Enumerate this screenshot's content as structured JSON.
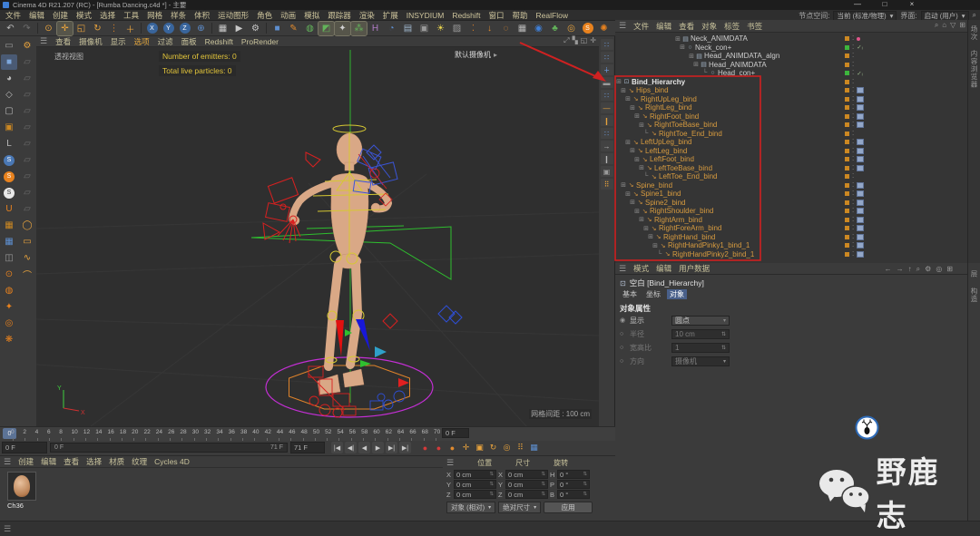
{
  "window": {
    "title": "Cinema 4D R21.207 (RC) - [Rumba Dancing.c4d *] - 主要",
    "controls": [
      "—",
      "□",
      "×"
    ]
  },
  "menubar": {
    "items": [
      "文件",
      "编辑",
      "创建",
      "模式",
      "选择",
      "工具",
      "网格",
      "样条",
      "体积",
      "运动图形",
      "角色",
      "动画",
      "模拟",
      "跟踪器",
      "渲染",
      "扩展",
      "INSYDIUM",
      "Redshift",
      "窗口",
      "帮助",
      "RealFlow"
    ],
    "node_space_label": "节点空间:",
    "node_space_value": "当前 (标准/物理)",
    "interface_label": "界面:",
    "interface_value": "启动 (用户)"
  },
  "toolbar": {
    "icons": [
      {
        "name": "undo",
        "glyph": "↶",
        "color": "#b8b8b8"
      },
      {
        "name": "redo",
        "glyph": "↷",
        "color": "#6e6e6e"
      },
      {
        "name": "sep"
      },
      {
        "name": "live-selection",
        "glyph": "⊙",
        "color": "#e8a33d"
      },
      {
        "name": "move-tool",
        "glyph": "✛",
        "color": "#e8a33d",
        "active": true
      },
      {
        "name": "scale-tool",
        "glyph": "◱",
        "color": "#e8a33d"
      },
      {
        "name": "rotate-tool",
        "glyph": "↻",
        "color": "#e8a33d"
      },
      {
        "name": "recent-tools",
        "glyph": "⋮",
        "color": "#cc7a29"
      },
      {
        "name": "add-tool",
        "glyph": "＋",
        "color": "#e8a33d"
      },
      {
        "name": "sep"
      },
      {
        "name": "lock-x",
        "glyph": "X",
        "color": "#fff",
        "bg": "#39659c",
        "round": true
      },
      {
        "name": "lock-y",
        "glyph": "Y",
        "color": "#fff",
        "bg": "#39659c",
        "round": true
      },
      {
        "name": "lock-z",
        "glyph": "Z",
        "color": "#fff",
        "bg": "#39659c",
        "round": true
      },
      {
        "name": "coordinate-system",
        "glyph": "⊕",
        "color": "#5e8fd0"
      },
      {
        "name": "sep"
      },
      {
        "name": "render-view",
        "glyph": "▦",
        "color": "#c8c8c8"
      },
      {
        "name": "render-marked",
        "glyph": "▶",
        "color": "#c8c8c8"
      },
      {
        "name": "render-settings",
        "glyph": "⚙",
        "color": "#c8c8c8"
      },
      {
        "name": "sep"
      },
      {
        "name": "primitive-cube",
        "glyph": "■",
        "color": "#5e8fd0"
      },
      {
        "name": "pen-spline",
        "glyph": "✎",
        "color": "#e08a2e"
      },
      {
        "name": "subdivision-surface",
        "glyph": "◍",
        "color": "#63b35a"
      },
      {
        "name": "bend-deformer",
        "glyph": "◩",
        "color": "#63b35a",
        "active": true
      },
      {
        "name": "mograph",
        "glyph": "✦",
        "color": "#d0d0d0",
        "active": true
      },
      {
        "name": "cloner",
        "glyph": "⁂",
        "color": "#63b35a",
        "active": true
      },
      {
        "name": "field-force",
        "glyph": "H",
        "color": "#b07cc6"
      },
      {
        "name": "volume",
        "glyph": "◔",
        "color": "#5e8fd0"
      },
      {
        "name": "floor",
        "glyph": "▤",
        "color": "#9fb6cc"
      },
      {
        "name": "camera",
        "glyph": "▣",
        "color": "#9a9a9a"
      },
      {
        "name": "light",
        "glyph": "☀",
        "color": "#e8d44d"
      },
      {
        "name": "sky",
        "glyph": "▨",
        "color": "#9a9a9a"
      },
      {
        "name": "dots-menu",
        "glyph": "⁚",
        "color": "#cc7a29"
      },
      {
        "name": "solo-arrow",
        "glyph": "↓",
        "color": "#e08a2e"
      },
      {
        "name": "dotted-selection",
        "glyph": "◌",
        "color": "#e08a2e"
      },
      {
        "name": "array-grid",
        "glyph": "▦",
        "color": "#b8b8b8"
      },
      {
        "name": "xref",
        "glyph": "◉",
        "color": "#3f7fd6"
      },
      {
        "name": "jb-plugin",
        "glyph": "♣",
        "color": "#63b35a"
      },
      {
        "name": "target-gear",
        "glyph": "◎",
        "color": "#e8a33d"
      },
      {
        "name": "s-logo",
        "glyph": "S",
        "color": "#fff",
        "bg": "#e8821e",
        "round": true
      },
      {
        "name": "xparticles",
        "glyph": "✺",
        "color": "#e8821e"
      }
    ]
  },
  "left_toolbar": {
    "col_a": [
      {
        "name": "make-editable",
        "glyph": "▭",
        "color": "#9a9a9a"
      },
      {
        "name": "model-mode",
        "glyph": "■",
        "color": "#7da7dc",
        "active": true
      },
      {
        "name": "texture-mode",
        "glyph": "◕",
        "color": "#b8b8b8"
      },
      {
        "name": "workplane-mode",
        "glyph": "◇",
        "color": "#b8b8b8"
      },
      {
        "name": "object-mode",
        "glyph": "▢",
        "color": "#b8b8b8"
      },
      {
        "name": "animation-mode",
        "glyph": "▣",
        "color": "#cc8822"
      },
      {
        "name": "axis-mode",
        "glyph": "L",
        "color": "#b8b8b8"
      },
      {
        "name": "badge-blue-s",
        "glyph": "S",
        "color": "#fff",
        "bg": "#4a78b5"
      },
      {
        "name": "badge-orange-s",
        "glyph": "S",
        "color": "#fff",
        "bg": "#e8821e"
      },
      {
        "name": "badge-white-s",
        "glyph": "S",
        "color": "#333",
        "bg": "#e8e8e8"
      },
      {
        "name": "magnet-snap",
        "glyph": "U",
        "color": "#e8821e"
      },
      {
        "name": "grid-orange",
        "glyph": "▦",
        "color": "#cc8822"
      },
      {
        "name": "grid-blue",
        "glyph": "▦",
        "color": "#5e8fd0"
      },
      {
        "name": "grid-dark",
        "glyph": "◫",
        "color": "#9a9a9a"
      },
      {
        "name": "xp-circle-1",
        "glyph": "⊙",
        "color": "#e8821e"
      },
      {
        "name": "xp-circle-2",
        "glyph": "◍",
        "color": "#e8821e"
      },
      {
        "name": "xp-circle-3",
        "glyph": "✦",
        "color": "#e8821e"
      },
      {
        "name": "xp-circle-4",
        "glyph": "◎",
        "color": "#e8821e"
      },
      {
        "name": "xp-circle-5",
        "glyph": "❋",
        "color": "#e8821e"
      }
    ],
    "col_b": [
      {
        "name": "gear-cursor",
        "glyph": "⚙",
        "color": "#e8a33d"
      },
      {
        "name": "tool-dim-1",
        "glyph": "▱",
        "color": "#6a6a6a"
      },
      {
        "name": "tool-dim-2",
        "glyph": "▱",
        "color": "#6a6a6a"
      },
      {
        "name": "tool-dim-3",
        "glyph": "▱",
        "color": "#6a6a6a"
      },
      {
        "name": "tool-dim-4",
        "glyph": "▱",
        "color": "#6a6a6a"
      },
      {
        "name": "tool-dim-5",
        "glyph": "▱",
        "color": "#6a6a6a"
      },
      {
        "name": "tool-dim-6",
        "glyph": "▱",
        "color": "#6a6a6a"
      },
      {
        "name": "tool-dim-7",
        "glyph": "▱",
        "color": "#6a6a6a"
      },
      {
        "name": "tool-dim-8",
        "glyph": "▱",
        "color": "#6a6a6a"
      },
      {
        "name": "tool-dim-9",
        "glyph": "▱",
        "color": "#6a6a6a"
      },
      {
        "name": "tool-dim-10",
        "glyph": "▱",
        "color": "#6a6a6a"
      },
      {
        "name": "select-circle",
        "glyph": "◯",
        "color": "#e8a33d"
      },
      {
        "name": "select-rect",
        "glyph": "▭",
        "color": "#e8a33d"
      },
      {
        "name": "select-lasso",
        "glyph": "∿",
        "color": "#e8a33d"
      },
      {
        "name": "select-poly",
        "glyph": "⌒",
        "color": "#e8a33d"
      }
    ]
  },
  "right_strip": {
    "icons": [
      {
        "name": "char-tool-1",
        "glyph": "∷",
        "color": "#6d9ce0"
      },
      {
        "name": "char-tool-2",
        "glyph": "∷",
        "color": "#6d9ce0"
      },
      {
        "name": "char-tool-3",
        "glyph": "∔",
        "color": "#6d9ce0"
      },
      {
        "name": "char-tool-4",
        "glyph": "▬",
        "color": "#9a9a9a"
      },
      {
        "name": "char-tool-5",
        "glyph": "∷",
        "color": "#6d9ce0"
      },
      {
        "name": "char-tool-6",
        "glyph": "—",
        "color": "#e8a33d"
      },
      {
        "name": "char-tool-7",
        "glyph": "❙",
        "color": "#e8a33d"
      },
      {
        "name": "char-tool-8",
        "glyph": "∷",
        "color": "#6d9ce0"
      },
      {
        "name": "char-tool-9",
        "glyph": "→",
        "color": "#b8b8b8"
      },
      {
        "name": "char-tool-10",
        "glyph": "❙",
        "color": "#b8b8b8"
      },
      {
        "name": "char-tool-11",
        "glyph": "▣",
        "color": "#9a9a9a"
      },
      {
        "name": "char-tool-12",
        "glyph": "⠿",
        "color": "#e8a33d"
      }
    ]
  },
  "viewport": {
    "menu": [
      "查看",
      "摄像机",
      "显示",
      "选项",
      "过滤",
      "面板",
      "Redshift",
      "ProRender"
    ],
    "highlight_item": "选项",
    "corner_icons": [
      "⤢",
      "▚",
      "◱",
      "✛"
    ],
    "view_label": "透视视图",
    "overlay": [
      "Number of emitters: 0",
      "Total live particles: 0"
    ],
    "camera_label": "默认摄像机",
    "grid_label": "网格间距 : 100 cm",
    "axis_x": "X",
    "axis_y": "Y"
  },
  "object_manager": {
    "menu": [
      "文件",
      "编辑",
      "查看",
      "对象",
      "标签",
      "书签"
    ],
    "header_icons": [
      "⌕",
      "⌂",
      "▽",
      "⊞"
    ],
    "side_tabs": [
      "场次",
      "内容浏览器"
    ],
    "rows": [
      {
        "label": "Neck_ANIMDATA",
        "indent": 13,
        "color": "grey",
        "icon": "anim",
        "exp": "⊞",
        "square": "orange",
        "tag": "reddot"
      },
      {
        "label": "Neck_con+",
        "indent": 14,
        "color": "grey",
        "icon": "con",
        "exp": "⊞",
        "square": "green",
        "tag": "check"
      },
      {
        "label": "Head_ANIMDATA_algn",
        "indent": 16,
        "color": "grey",
        "icon": "anim",
        "exp": "⊞",
        "square": "orange",
        "tag": "none"
      },
      {
        "label": "Head_ANIMDATA",
        "indent": 17,
        "color": "grey",
        "icon": "anim",
        "exp": "⊞",
        "square": "orange",
        "tag": "none"
      },
      {
        "label": "Head_con+",
        "indent": 19,
        "color": "grey",
        "icon": "con",
        "exp": "└",
        "square": "green",
        "tag": "check"
      },
      {
        "label": "Bind_Hierarchy",
        "indent": 0,
        "color": "white",
        "icon": "null",
        "exp": "⊞",
        "square": "orange",
        "tag": "none"
      },
      {
        "label": "Hips_bind",
        "indent": 1,
        "color": "orange",
        "icon": "bone",
        "exp": "⊞",
        "square": "orange",
        "tag": "joint"
      },
      {
        "label": "RightUpLeg_bind",
        "indent": 2,
        "color": "orange",
        "icon": "bone",
        "exp": "⊞",
        "square": "orange",
        "tag": "joint"
      },
      {
        "label": "RightLeg_bind",
        "indent": 3,
        "color": "orange",
        "icon": "bone",
        "exp": "⊞",
        "square": "orange",
        "tag": "joint"
      },
      {
        "label": "RightFoot_bind",
        "indent": 4,
        "color": "orange",
        "icon": "bone",
        "exp": "⊞",
        "square": "orange",
        "tag": "joint"
      },
      {
        "label": "RightToeBase_bind",
        "indent": 5,
        "color": "orange",
        "icon": "bone",
        "exp": "⊞",
        "square": "orange",
        "tag": "joint"
      },
      {
        "label": "RightToe_End_bind",
        "indent": 6,
        "color": "orange",
        "icon": "bone",
        "exp": "└",
        "square": "orange",
        "tag": "none"
      },
      {
        "label": "LeftUpLeg_bind",
        "indent": 2,
        "color": "orange",
        "icon": "bone",
        "exp": "⊞",
        "square": "orange",
        "tag": "joint"
      },
      {
        "label": "LeftLeg_bind",
        "indent": 3,
        "color": "orange",
        "icon": "bone",
        "exp": "⊞",
        "square": "orange",
        "tag": "joint"
      },
      {
        "label": "LeftFoot_bind",
        "indent": 4,
        "color": "orange",
        "icon": "bone",
        "exp": "⊞",
        "square": "orange",
        "tag": "joint"
      },
      {
        "label": "LeftToeBase_bind",
        "indent": 5,
        "color": "orange",
        "icon": "bone",
        "exp": "⊞",
        "square": "orange",
        "tag": "joint"
      },
      {
        "label": "LeftToe_End_bind",
        "indent": 6,
        "color": "orange",
        "icon": "bone",
        "exp": "└",
        "square": "orange",
        "tag": "none"
      },
      {
        "label": "Spine_bind",
        "indent": 1,
        "color": "orange",
        "icon": "bone",
        "exp": "⊞",
        "square": "orange",
        "tag": "joint"
      },
      {
        "label": "Spine1_bind",
        "indent": 2,
        "color": "orange",
        "icon": "bone",
        "exp": "⊞",
        "square": "orange",
        "tag": "joint"
      },
      {
        "label": "Spine2_bind",
        "indent": 3,
        "color": "orange",
        "icon": "bone",
        "exp": "⊞",
        "square": "orange",
        "tag": "joint"
      },
      {
        "label": "RightShoulder_bind",
        "indent": 4,
        "color": "orange",
        "icon": "bone",
        "exp": "⊞",
        "square": "orange",
        "tag": "joint"
      },
      {
        "label": "RightArm_bind",
        "indent": 5,
        "color": "orange",
        "icon": "bone",
        "exp": "⊞",
        "square": "orange",
        "tag": "joint"
      },
      {
        "label": "RightForeArm_bind",
        "indent": 6,
        "color": "orange",
        "icon": "bone",
        "exp": "⊞",
        "square": "orange",
        "tag": "joint"
      },
      {
        "label": "RightHand_bind",
        "indent": 7,
        "color": "orange",
        "icon": "bone",
        "exp": "⊞",
        "square": "orange",
        "tag": "joint"
      },
      {
        "label": "RightHandPinky1_bind_1",
        "indent": 8,
        "color": "orange",
        "icon": "bone",
        "exp": "⊞",
        "square": "orange",
        "tag": "joint"
      },
      {
        "label": "RightHandPinky2_bind_1",
        "indent": 9,
        "color": "orange",
        "icon": "bone",
        "exp": "└",
        "square": "orange",
        "tag": "joint"
      }
    ]
  },
  "attribute_manager": {
    "menu": [
      "模式",
      "编辑",
      "用户数据"
    ],
    "header_icons": [
      "←",
      "→",
      "↑",
      "⌕",
      "⚙",
      "◎",
      "⊞"
    ],
    "object_label": "空白 [Bind_Hierarchy]",
    "tabs": [
      "基本",
      "坐标",
      "对象"
    ],
    "active_tab": "对象",
    "section": "对象属性",
    "props": [
      {
        "label": "显示",
        "value": "圆点",
        "control": "select",
        "enabled": true
      },
      {
        "label": "半径",
        "value": "10 cm",
        "control": "spinner",
        "enabled": false
      },
      {
        "label": "宽高比",
        "value": "1",
        "control": "spinner",
        "enabled": false
      },
      {
        "label": "方向",
        "value": "摄像机",
        "control": "select",
        "enabled": false
      }
    ],
    "side_tabs": [
      "层",
      "构造"
    ]
  },
  "timeline": {
    "ticks": [
      0,
      2,
      4,
      6,
      8,
      10,
      12,
      14,
      16,
      18,
      20,
      22,
      24,
      26,
      28,
      30,
      32,
      34,
      36,
      38,
      40,
      42,
      44,
      46,
      48,
      50,
      52,
      54,
      56,
      58,
      60,
      62,
      64,
      66,
      68,
      70
    ],
    "playhead": "0",
    "current_frame": "0 F",
    "frame_field": "0 F",
    "range_start": "0 F",
    "range_end": "71 F",
    "end_field": "71 F",
    "playback": [
      {
        "name": "goto-start",
        "glyph": "|◀"
      },
      {
        "name": "prev-key",
        "glyph": "◀|"
      },
      {
        "name": "prev-frame",
        "glyph": "◀"
      },
      {
        "name": "play",
        "glyph": "▶"
      },
      {
        "name": "next-frame",
        "glyph": "▶|"
      },
      {
        "name": "goto-end",
        "glyph": "▶|"
      }
    ],
    "record": [
      {
        "name": "record-keyframe",
        "glyph": "●",
        "color": "#d33a3a"
      },
      {
        "name": "autokey",
        "glyph": "●",
        "color": "#d33a3a"
      },
      {
        "name": "keyframe-selection",
        "glyph": "●",
        "color": "#e08a2e"
      },
      {
        "name": "key-position",
        "glyph": "✛",
        "color": "#e8a33d"
      },
      {
        "name": "key-scale",
        "glyph": "▣",
        "color": "#e8a33d"
      },
      {
        "name": "key-rotation",
        "glyph": "↻",
        "color": "#e8a33d"
      },
      {
        "name": "key-parameter",
        "glyph": "◎",
        "color": "#e8a33d"
      },
      {
        "name": "key-pla",
        "glyph": "⠿",
        "color": "#e8a33d"
      },
      {
        "name": "timeline-grid",
        "glyph": "▦",
        "color": "#5e8fd0"
      }
    ]
  },
  "material_manager": {
    "menu": [
      "创建",
      "编辑",
      "查看",
      "选择",
      "材质",
      "纹理",
      "Cycles 4D"
    ],
    "materials": [
      {
        "name": "Ch36"
      }
    ]
  },
  "coordinates": {
    "headers": [
      "位置",
      "尺寸",
      "旋转"
    ],
    "rows": [
      {
        "axis": "X",
        "pos": "0 cm",
        "size_axis": "X",
        "size": "0 cm",
        "rot_axis": "H",
        "rot": "0 °"
      },
      {
        "axis": "Y",
        "pos": "0 cm",
        "size_axis": "Y",
        "size": "0 cm",
        "rot_axis": "P",
        "rot": "0 °"
      },
      {
        "axis": "Z",
        "pos": "0 cm",
        "size_axis": "Z",
        "size": "0 cm",
        "rot_axis": "B",
        "rot": "0 °"
      }
    ],
    "mode": "对象 (相对)",
    "size_mode": "绝对尺寸",
    "apply_label": "应用"
  },
  "watermark": {
    "text": "野鹿志"
  }
}
